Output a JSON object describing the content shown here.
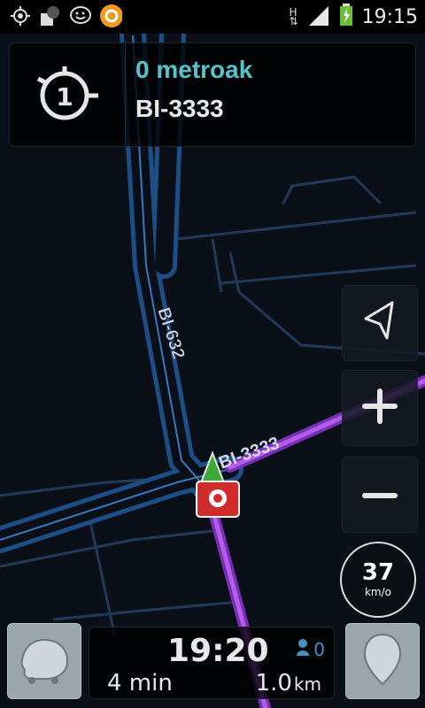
{
  "status_bar": {
    "icons": [
      "gps-icon",
      "profile-icon",
      "waze-icon",
      "app-orange-icon"
    ],
    "network_type": "H",
    "time": "19:15"
  },
  "navigation": {
    "turn_icon": "roundabout-exit-1-icon",
    "roundabout_exit": "1",
    "distance": "0 metroak",
    "street": "BI-3333"
  },
  "map": {
    "road_labels": [
      "BI-632",
      "BI-3333"
    ],
    "route_color": "#9b3fd8",
    "road_color": "#2a5f9e"
  },
  "controls": {
    "compass_icon": "compass-arrow-icon",
    "zoom_in_icon": "plus-icon",
    "zoom_out_icon": "minus-icon"
  },
  "speedometer": {
    "speed": "37",
    "unit": "km/o"
  },
  "eta": {
    "arrival_time": "19:20",
    "users_count": "0",
    "duration": "4 min",
    "distance_value": "1.0",
    "distance_unit": "km"
  },
  "bottom": {
    "menu_icon": "waze-menu-icon",
    "report_icon": "location-pin-icon"
  }
}
